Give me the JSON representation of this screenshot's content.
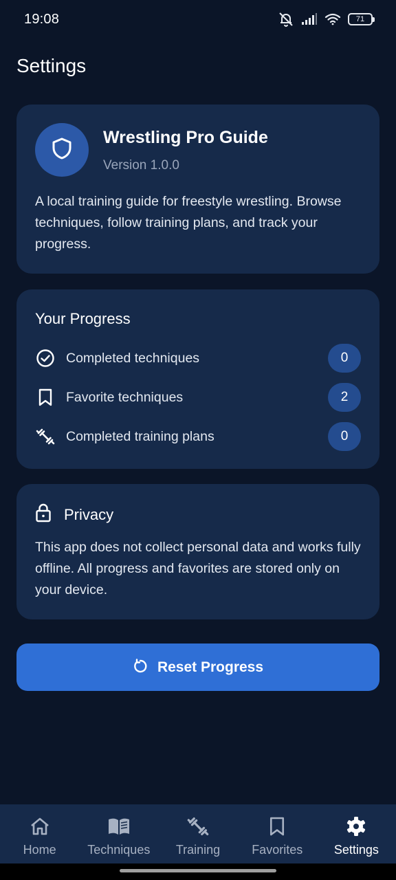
{
  "status_bar": {
    "time": "19:08",
    "battery": "71",
    "icons": [
      "mute-bell-icon",
      "signal-icon",
      "wifi-icon",
      "battery-icon"
    ]
  },
  "page": {
    "title": "Settings"
  },
  "app_card": {
    "name": "Wrestling Pro Guide",
    "version": "Version 1.0.0",
    "description": "A local training guide for freestyle wrestling. Browse techniques, follow training plans, and track your progress.",
    "icon": "shield-icon"
  },
  "progress": {
    "title": "Your Progress",
    "rows": [
      {
        "label": "Completed techniques",
        "count": "0",
        "icon": "check-circle-icon"
      },
      {
        "label": "Favorite techniques",
        "count": "2",
        "icon": "bookmark-icon"
      },
      {
        "label": "Completed training plans",
        "count": "0",
        "icon": "dumbbell-icon"
      }
    ]
  },
  "privacy": {
    "title": "Privacy",
    "text": "This app does not collect personal data and works fully offline. All progress and favorites are stored only on your device.",
    "icon": "lock-icon"
  },
  "reset": {
    "label": "Reset Progress",
    "icon": "refresh-icon"
  },
  "nav": {
    "active": "Settings",
    "items": [
      {
        "label": "Home",
        "icon": "home-icon"
      },
      {
        "label": "Techniques",
        "icon": "book-icon"
      },
      {
        "label": "Training",
        "icon": "dumbbell-icon"
      },
      {
        "label": "Favorites",
        "icon": "bookmark-icon"
      },
      {
        "label": "Settings",
        "icon": "gear-icon"
      }
    ]
  },
  "colors": {
    "background": "#0b1528",
    "card": "#162a4a",
    "accent": "#2f6fd6",
    "badge": "#244c8f"
  }
}
